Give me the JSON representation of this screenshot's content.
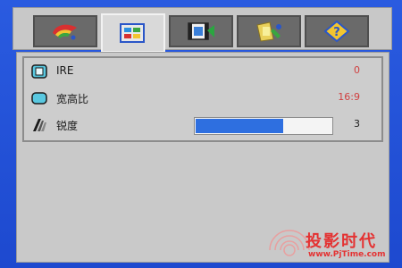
{
  "tabs": [
    {
      "icon": "color-palette-icon",
      "active": false
    },
    {
      "icon": "picture-settings-icon",
      "active": true
    },
    {
      "icon": "video-film-icon",
      "active": false
    },
    {
      "icon": "setup-tools-icon",
      "active": false
    },
    {
      "icon": "help-info-icon",
      "active": false
    }
  ],
  "rows": [
    {
      "label": "IRE",
      "value": "0",
      "icon": "ire-screen-icon"
    },
    {
      "label": "宽高比",
      "value": "16:9",
      "icon": "aspect-ratio-icon"
    },
    {
      "label": "锐度",
      "value": "3",
      "icon": "sharpness-icon",
      "level_percent": 65
    }
  ],
  "watermark": {
    "title": "投影时代",
    "url": "www.PjTime.com"
  },
  "colors": {
    "background": "#1f4fd6",
    "panel": "#c9c9c9",
    "value_red": "#d04040",
    "slider_fill": "#2e6fe0",
    "watermark_red": "#e43232"
  }
}
